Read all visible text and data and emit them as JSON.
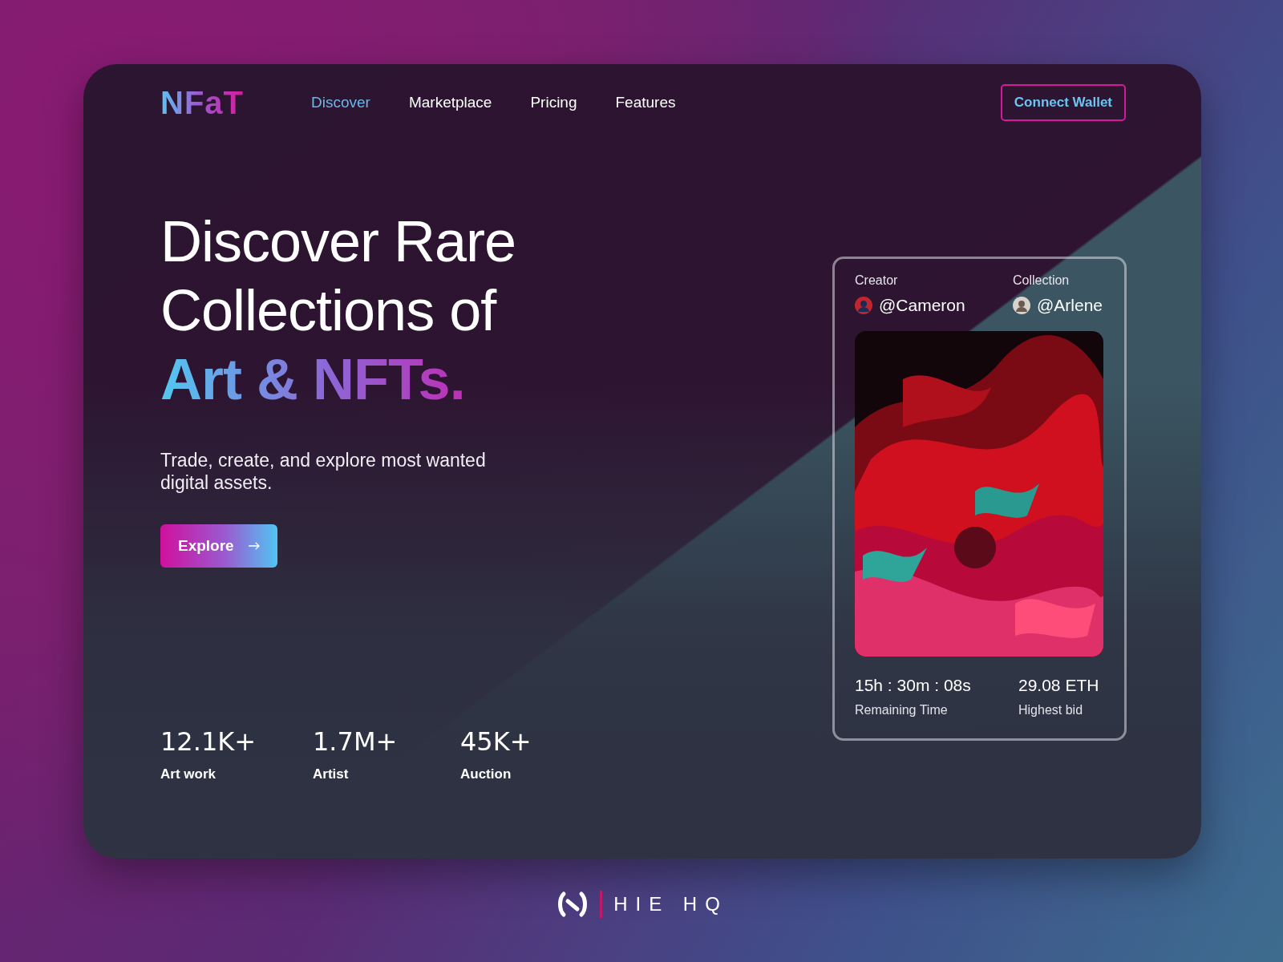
{
  "brand": {
    "logo": "NFaT"
  },
  "nav": [
    {
      "label": "Discover",
      "selected": true
    },
    {
      "label": "Marketplace",
      "selected": false
    },
    {
      "label": "Pricing",
      "selected": false
    },
    {
      "label": "Features",
      "selected": false
    }
  ],
  "connect_button": "Connect Wallet",
  "hero": {
    "title_lines": [
      "Discover Rare",
      "Collections of"
    ],
    "highlight": "Art & NFTs.",
    "subtitle": "Trade, create, and explore most wanted digital assets.",
    "button": "Explore"
  },
  "stats": [
    {
      "value": "12.1K+",
      "label": "Art work"
    },
    {
      "value": "1.7M+",
      "label": "Artist"
    },
    {
      "value": "45K+",
      "label": "Auction"
    }
  ],
  "nft_card": {
    "people": [
      {
        "role": "Creator",
        "handle": "@Cameron"
      },
      {
        "role": "Collection",
        "handle": "@Arlene"
      }
    ],
    "info": [
      {
        "value": "15h : 30m : 08s",
        "label": "Remaining Time"
      },
      {
        "value": "29.08 ETH",
        "label": "Highest bid"
      }
    ]
  },
  "footer_brand": "HIE HQ"
}
